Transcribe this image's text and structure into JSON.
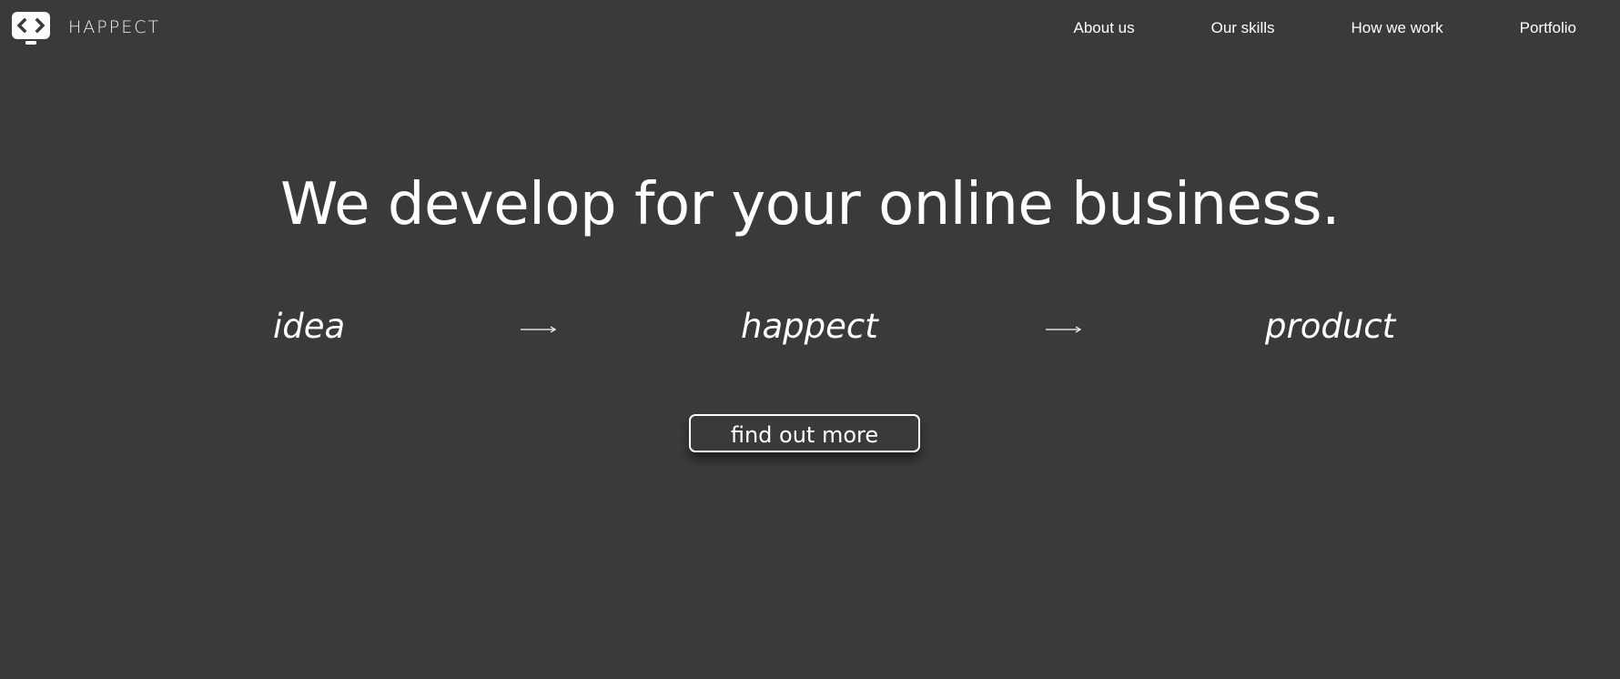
{
  "brand": {
    "name": "HAPPECT",
    "logo_icon": "code-monitor-icon"
  },
  "nav": {
    "items": [
      {
        "label": "About us"
      },
      {
        "label": "Our skills"
      },
      {
        "label": "How we work"
      },
      {
        "label": "Portfolio"
      }
    ]
  },
  "hero": {
    "headline": "We develop for your online business.",
    "flow": {
      "steps": [
        "idea",
        "happect",
        "product"
      ],
      "arrow_icon": "long-arrow-right-icon"
    },
    "cta_label": "find out more"
  },
  "colors": {
    "background": "#3a3a3a",
    "text": "#ffffff"
  }
}
